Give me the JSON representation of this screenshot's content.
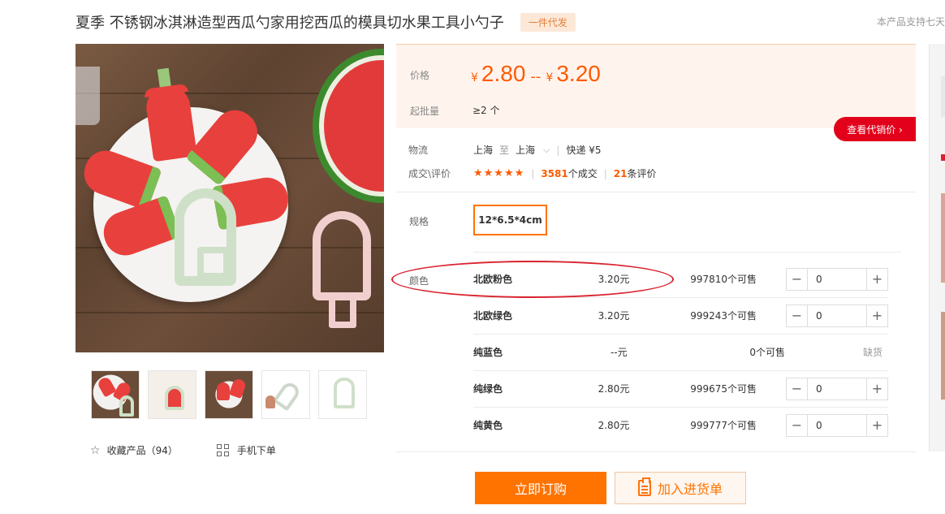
{
  "header": {
    "title": "夏季 不锈钢冰淇淋造型西瓜勺家用挖西瓜的模具切水果工具小勺子",
    "badge": "一件代发",
    "support_note": "本产品支持七天"
  },
  "gallery": {
    "main_image_icon": "watermelon-popsicle-photo",
    "thumbnails": [
      {
        "icon": "thumb-plate-icon"
      },
      {
        "icon": "thumb-hands-icon"
      },
      {
        "icon": "thumb-slice-icon"
      },
      {
        "icon": "thumb-cutter-icon"
      },
      {
        "icon": "thumb-mold-icon"
      }
    ],
    "favorite_label": "收藏产品（94）",
    "mobile_order_label": "手机下单"
  },
  "price": {
    "label": "价格",
    "currency": "¥",
    "min": "2.80",
    "separator": "--",
    "max": "3.20",
    "moq_label": "起批量",
    "moq_value": "≥2 个",
    "agent_button": "查看代销价 ›"
  },
  "logistics": {
    "label": "物流",
    "from": "上海",
    "to_word": "至",
    "to": "上海",
    "chevron": "⌵",
    "divider": "|",
    "shipping": "快递 ¥5"
  },
  "reviews": {
    "label": "成交\\评价",
    "stars": "★★★★★",
    "rating": 5,
    "deals_count": "3581",
    "deals_label": "个成交",
    "divider": "|",
    "review_count": "21",
    "review_label": "条评价"
  },
  "spec": {
    "label": "规格",
    "selected": "12*6.5*4cm"
  },
  "colors": {
    "label": "颜色",
    "rows": [
      {
        "name": "北欧粉色",
        "price": "3.20元",
        "stock": "997810个可售",
        "qty": "0",
        "available": true
      },
      {
        "name": "北欧绿色",
        "price": "3.20元",
        "stock": "999243个可售",
        "qty": "0",
        "available": true
      },
      {
        "name": "纯蓝色",
        "price": "--元",
        "stock": "0个可售",
        "status": "缺货",
        "available": false
      },
      {
        "name": "纯绿色",
        "price": "2.80元",
        "stock": "999675个可售",
        "qty": "0",
        "available": true
      },
      {
        "name": "纯黄色",
        "price": "2.80元",
        "stock": "999777个可售",
        "qty": "0",
        "available": true
      }
    ],
    "minus": "−",
    "plus": "+"
  },
  "actions": {
    "buy_now": "立即订购",
    "add_to_list": "加入进货单"
  },
  "colors_palette": {
    "accent": "#ff7300",
    "price": "#ff5a00",
    "agent_red": "#e3001b",
    "annotation": "#d9232f"
  }
}
